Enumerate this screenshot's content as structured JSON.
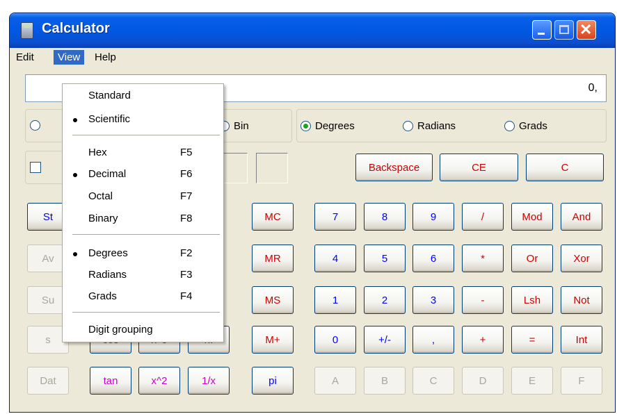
{
  "window": {
    "title": "Calculator"
  },
  "menubar": {
    "items": [
      "Edit",
      "View",
      "Help"
    ]
  },
  "display": {
    "value": "0,"
  },
  "radix": {
    "visible_label": "Bin"
  },
  "angle": {
    "options": [
      "Degrees",
      "Radians",
      "Grads"
    ],
    "selected": "Degrees"
  },
  "edit_buttons": [
    "Backspace",
    "CE",
    "C"
  ],
  "stat_buttons": [
    "St",
    "Av",
    "Su",
    "s",
    "Dat"
  ],
  "sci_buttons": {
    "row4": [
      "cos",
      "x^3",
      "n!"
    ],
    "row5": [
      "tan",
      "x^2",
      "1/x"
    ],
    "partial": "g"
  },
  "memory_buttons": [
    "MC",
    "MR",
    "MS",
    "M+",
    "pi"
  ],
  "keypad": [
    [
      "7",
      "8",
      "9",
      "/",
      "Mod",
      "And"
    ],
    [
      "4",
      "5",
      "6",
      "*",
      "Or",
      "Xor"
    ],
    [
      "1",
      "2",
      "3",
      "-",
      "Lsh",
      "Not"
    ],
    [
      "0",
      "+/-",
      ",",
      "+",
      "=",
      "Int"
    ],
    [
      "A",
      "B",
      "C",
      "D",
      "E",
      "F"
    ]
  ],
  "view_menu": {
    "items": [
      {
        "label": "Standard",
        "key": "",
        "checked": false
      },
      {
        "label": "Scientific",
        "key": "",
        "checked": true
      },
      {
        "label": "Hex",
        "key": "F5",
        "checked": false
      },
      {
        "label": "Decimal",
        "key": "F6",
        "checked": true
      },
      {
        "label": "Octal",
        "key": "F7",
        "checked": false
      },
      {
        "label": "Binary",
        "key": "F8",
        "checked": false
      },
      {
        "label": "Degrees",
        "key": "F2",
        "checked": true
      },
      {
        "label": "Radians",
        "key": "F3",
        "checked": false
      },
      {
        "label": "Grads",
        "key": "F4",
        "checked": false
      },
      {
        "label": "Digit grouping",
        "key": "",
        "checked": false
      }
    ]
  },
  "colors": {
    "titlebar": "#0058e4",
    "menu_highlight": "#316ac5",
    "digit_text": "#0000ff",
    "operator_text": "#d00000",
    "function_text": "#d000d0"
  }
}
